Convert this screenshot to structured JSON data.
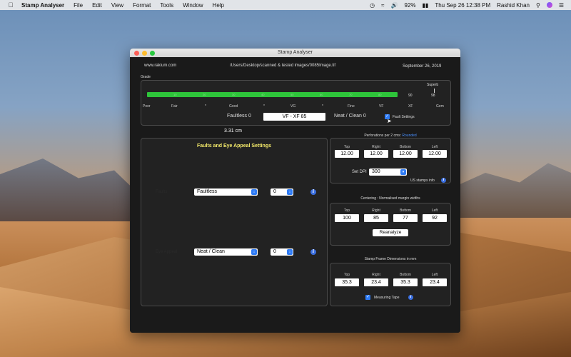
{
  "menubar": {
    "app_name": "Stamp Analyser",
    "menus": [
      "File",
      "Edit",
      "View",
      "Format",
      "Tools",
      "Window",
      "Help"
    ],
    "battery": "92%",
    "datetime": "Thu Sep 26  12:38 PM",
    "user": "Rashid Khan"
  },
  "window": {
    "title": "Stamp Analyser",
    "website": "www.rakium.com",
    "file_path": "/Users/Desktop/scanned & tested images/0085Image.tif",
    "date": "September 26, 2019"
  },
  "grade": {
    "label": "Grade",
    "superb_label": "Superb",
    "bar_ticks": [
      "10",
      "20",
      "30",
      "40",
      "50",
      "60",
      "70",
      "80"
    ],
    "tick_90": "90",
    "tick_98": "98",
    "scale": [
      "Poor",
      "Fair",
      "*",
      "Good",
      "*",
      "VG",
      "*",
      "Fine",
      "VF",
      "XF",
      "Gem"
    ],
    "faultless": "Faultless 0",
    "grade_value": "VF  - XF 85",
    "neat_clean": "Neat / Clean 0",
    "fault_settings": "Fault Settings",
    "measure": "3.31 cm"
  },
  "faults": {
    "title": "Faults and Eye Appeal Settings",
    "row1_label": "Faults",
    "row1_select": "Faultless",
    "row1_count": "0",
    "row2_label": "Eye Appeal",
    "row2_select": "Neat / Clean",
    "row2_count": "0"
  },
  "perforations": {
    "title": "Perforations per 2 cms:",
    "rounded": "Rounded",
    "headers": [
      "Top",
      "Right",
      "Bottom",
      "Left"
    ],
    "values": [
      "12.00",
      "12.00",
      "12.00",
      "12.00"
    ],
    "dpi_label": "Set DPI",
    "dpi_value": "300",
    "us_stamps": "US stamps info"
  },
  "centering": {
    "title": "Centering : Normalised margin widths",
    "headers": [
      "Top",
      "Right",
      "Bottom",
      "Left"
    ],
    "values": [
      "100",
      "85",
      "77",
      "92"
    ],
    "reanalyze": "Reanalyze"
  },
  "frame": {
    "title": "Stamp Frame Dimensions in mm",
    "headers": [
      "Top",
      "Right",
      "Bottom",
      "Left"
    ],
    "values": [
      "35.3",
      "23.4",
      "35.3",
      "23.4"
    ],
    "measuring_tape": "Measuring Tape"
  },
  "colors": {
    "grade_bar": "#2ec43a",
    "accent": "#2f7cf6",
    "title_yellow": "#f3e96a"
  }
}
